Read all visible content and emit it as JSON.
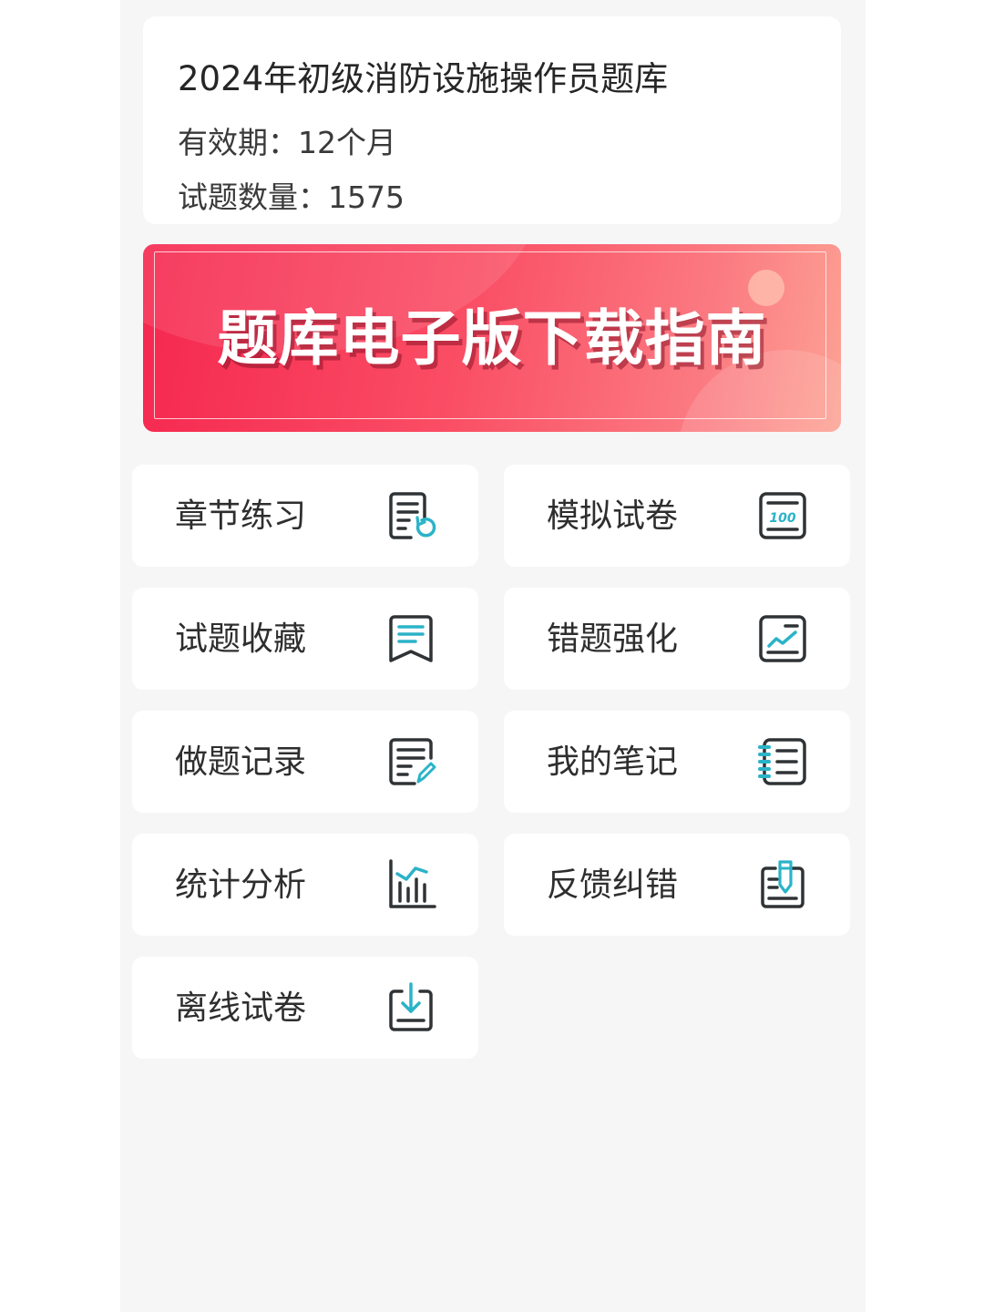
{
  "info": {
    "title": "2024年初级消防设施操作员题库",
    "validity": "有效期：12个月",
    "question_count": "试题数量：1575"
  },
  "banner": {
    "text": "题库电子版下载指南"
  },
  "menu": {
    "items": [
      {
        "label": "章节练习",
        "icon": "chapter-practice-icon"
      },
      {
        "label": "模拟试卷",
        "icon": "mock-exam-icon"
      },
      {
        "label": "试题收藏",
        "icon": "bookmark-icon"
      },
      {
        "label": "错题强化",
        "icon": "trend-chart-icon"
      },
      {
        "label": "做题记录",
        "icon": "edit-document-icon"
      },
      {
        "label": "我的笔记",
        "icon": "notebook-icon"
      },
      {
        "label": "统计分析",
        "icon": "bar-chart-icon"
      },
      {
        "label": "反馈纠错",
        "icon": "feedback-icon"
      },
      {
        "label": "离线试卷",
        "icon": "download-icon"
      }
    ]
  },
  "colors": {
    "accent": "#2bb3c8",
    "icon_dark": "#2f3336",
    "banner_start": "#f5274f",
    "banner_end": "#fca294",
    "background": "#f6f6f7"
  }
}
